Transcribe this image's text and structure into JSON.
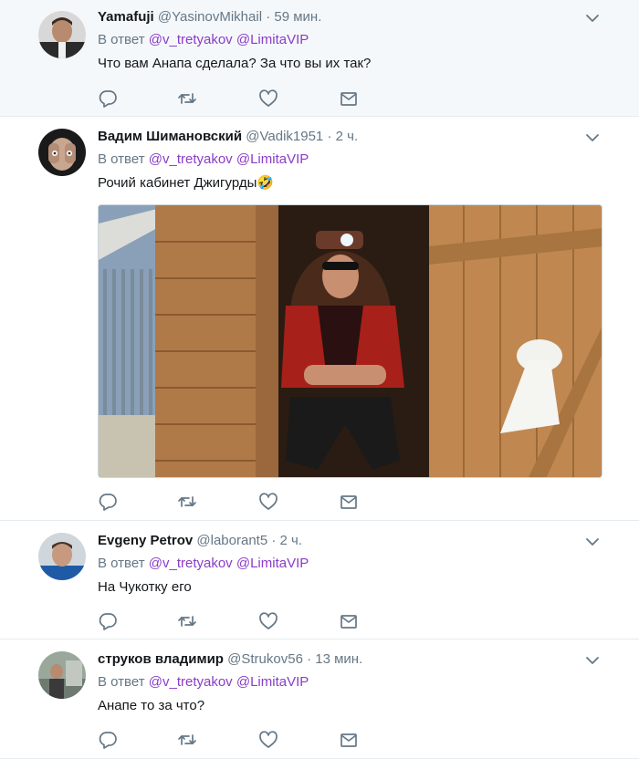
{
  "tweets": [
    {
      "name": "Yamafuji",
      "handle": "@YasinovMikhail",
      "dot": "·",
      "time": "59 мин.",
      "reply_prefix": "В ответ",
      "mention1": "@v_tretyakov",
      "mention2": "@LimitaVIP",
      "text": "Что вам Анапа сделала? За что вы их так?"
    },
    {
      "name": "Вадим Шимановский",
      "handle": "@Vadik1951",
      "dot": "·",
      "time": "2 ч.",
      "reply_prefix": "В ответ",
      "mention1": "@v_tretyakov",
      "mention2": "@LimitaVIP",
      "text": "Рочий кабинет Джигурды🤣"
    },
    {
      "name": "Evgeny Petrov",
      "handle": "@laborant5",
      "dot": "·",
      "time": "2 ч.",
      "reply_prefix": "В ответ",
      "mention1": "@v_tretyakov",
      "mention2": "@LimitaVIP",
      "text": "На Чукотку его"
    },
    {
      "name": "струков владимир",
      "handle": "@Strukov56",
      "dot": "·",
      "time": "13 мин.",
      "reply_prefix": "В ответ",
      "mention1": "@v_tretyakov",
      "mention2": "@LimitaVIP",
      "text": "Анапе то за что?"
    }
  ],
  "icons": {
    "caret": "chevron-down-icon",
    "reply": "reply-icon",
    "retweet": "retweet-icon",
    "like": "heart-icon",
    "dm": "envelope-icon"
  },
  "colors": {
    "mention": "#8a3cc8",
    "secondary_text": "#657786",
    "highlight_background": "#f5f8fa",
    "divider": "#e6ecf0"
  }
}
